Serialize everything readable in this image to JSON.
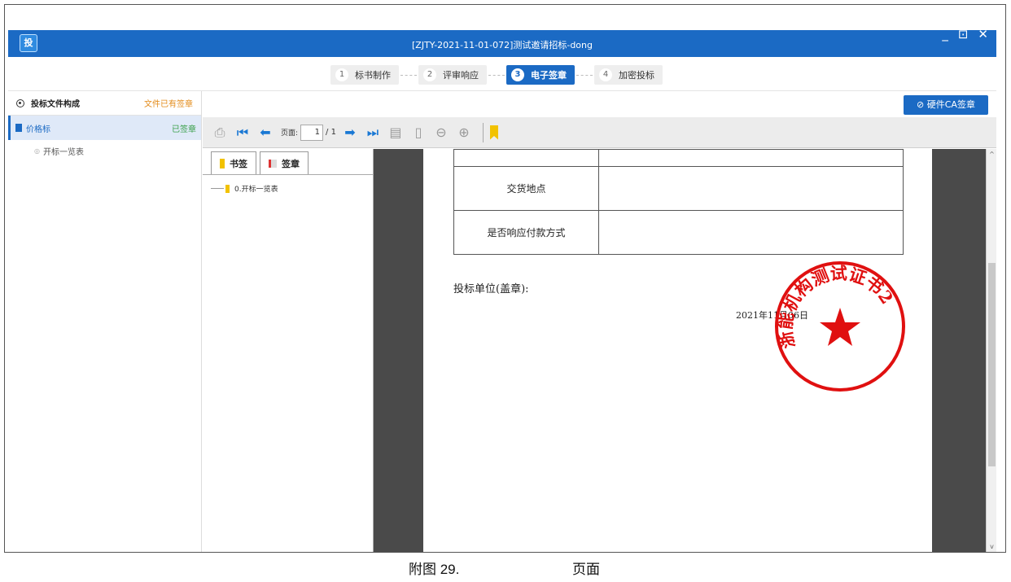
{
  "window": {
    "title": "[ZJTY-2021-11-01-072]测试邀请招标-dong",
    "logo_text": "投",
    "controls": [
      "_",
      "⊡",
      "✕"
    ]
  },
  "steps": [
    {
      "num": "1",
      "label": "标书制作",
      "active": false
    },
    {
      "num": "2",
      "label": "评审响应",
      "active": false
    },
    {
      "num": "3",
      "label": "电子签章",
      "active": true
    },
    {
      "num": "4",
      "label": "加密投标",
      "active": false
    }
  ],
  "sidebar": {
    "header_title": "投标文件构成",
    "header_status": "文件已有签章",
    "item_label": "价格标",
    "item_status": "已签章",
    "sub_label": "开标一览表"
  },
  "toolbar": {
    "ca_button": "硬件CA签章",
    "page_label": "页面:",
    "page_value": "1",
    "page_total": "/ 1"
  },
  "panel": {
    "tab_bookmarks": "书签",
    "tab_seals": "签章",
    "tree_item": "0.开标一览表"
  },
  "document": {
    "row1": "交货地点",
    "row2": "是否响应付款方式",
    "signature_label": "投标单位(盖章):",
    "date": "2021年11月06日",
    "stamp_text": "浙能机构测试证书2"
  },
  "caption": {
    "figure": "附图 29.",
    "label": "页面"
  },
  "colors": {
    "accent": "#1b6ac4",
    "stamp": "#e01010",
    "warning": "#e38b1a",
    "ok": "#3aa04a"
  }
}
